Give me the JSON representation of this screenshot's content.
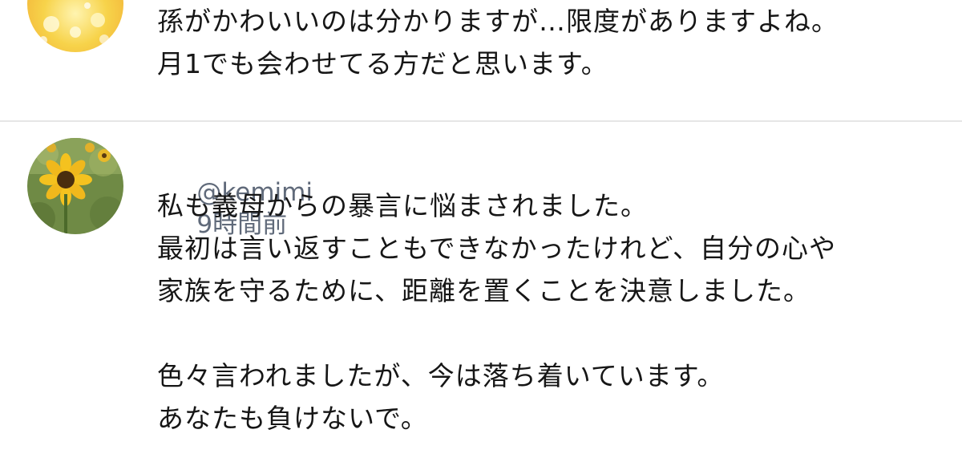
{
  "comments": [
    {
      "author": "",
      "time": "",
      "avatar_icon": "yellow-sparkle-avatar-icon",
      "lines": [
        "孫がかわいいのは分かりますが…限度がありますよね。",
        "月1でも会わせてる方だと思います。"
      ]
    },
    {
      "author": "@kemimi",
      "time": "9時間前",
      "avatar_icon": "sunflower-avatar-icon",
      "lines": [
        "私も義母からの暴言に悩まされました。",
        "最初は言い返すこともできなかったけれど、自分の心や",
        "家族を守るために、距離を置くことを決意しました。",
        "",
        "色々言われましたが、今は落ち着いています。",
        "あなたも負けないで。"
      ]
    }
  ],
  "colors": {
    "text": "#161616",
    "meta": "#606a7a",
    "divider": "#e6e6e6"
  }
}
